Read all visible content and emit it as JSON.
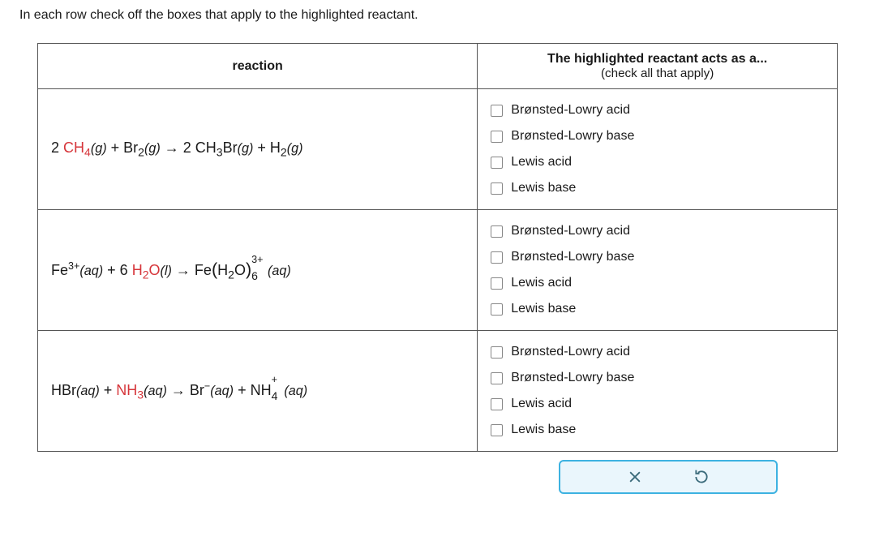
{
  "instruction": "In each row check off the boxes that apply to the highlighted reactant.",
  "headers": {
    "reaction": "reaction",
    "actsAs": "The highlighted reactant acts as a...",
    "actsAsSub": "(check all that apply)"
  },
  "options": {
    "blAcid": "Brønsted-Lowry acid",
    "blBase": "Brønsted-Lowry base",
    "lAcid": "Lewis acid",
    "lBase": "Lewis base"
  },
  "r1": {
    "a_pre": "2",
    "a_ch": "CH",
    "a_sub": "4",
    "a_state": "(g)",
    "plus1": " + Br",
    "br_sub": "2",
    "br_state": "(g)",
    "arrow": "  →  ",
    "b": "2 CH",
    "b_sub": "3",
    "b2": "Br",
    "b_state": "(g)",
    "plus2": " + H",
    "h_sub": "2",
    "h_state": "(g)"
  },
  "r2": {
    "fe": "Fe",
    "fe_sup": "3+",
    "fe_state": "(aq)",
    "plus1": " + 6",
    "h2o": "H",
    "h2o_sub": "2",
    "h2o_o": "O",
    "h2o_state": "(l)",
    "arrow": "  →  ",
    "prod": "Fe",
    "paren_open": "(",
    "prod_h": "H",
    "prod_sub": "2",
    "prod_o": "O",
    "paren_close": ")",
    "stack_sup": "3+",
    "stack_sub": "6",
    "prod_state": "(aq)"
  },
  "r3": {
    "hbr": "HBr",
    "hbr_state": "(aq)",
    "plus1": " + ",
    "nh": "NH",
    "nh_sub": "3",
    "nh_state": "(aq)",
    "arrow": "  →  ",
    "br": "Br",
    "br_sup": "−",
    "br_state": "(aq)",
    "plus2": " + NH",
    "nh4_stack_sup": "+",
    "nh4_stack_sub": "4",
    "nh4_state": "(aq)"
  }
}
